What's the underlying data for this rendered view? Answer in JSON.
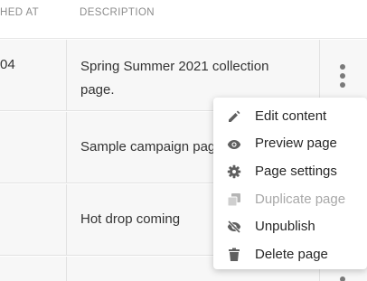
{
  "table": {
    "headers": {
      "published_at": "HED AT",
      "description": "DESCRIPTION"
    },
    "rows": [
      {
        "published_at": "04",
        "description": "Spring Summer 2021 collection page."
      },
      {
        "published_at": "",
        "description": "Sample campaign page"
      },
      {
        "published_at": "",
        "description": "Hot drop coming"
      },
      {
        "published_at": "",
        "description": ""
      }
    ]
  },
  "menu": {
    "items": [
      {
        "label": "Edit content",
        "icon": "pencil-icon",
        "disabled": false
      },
      {
        "label": "Preview page",
        "icon": "eye-icon",
        "disabled": false
      },
      {
        "label": "Page settings",
        "icon": "gear-icon",
        "disabled": false
      },
      {
        "label": "Duplicate page",
        "icon": "duplicate-icon",
        "disabled": true
      },
      {
        "label": "Unpublish",
        "icon": "eye-off-icon",
        "disabled": false
      },
      {
        "label": "Delete page",
        "icon": "trash-icon",
        "disabled": false
      }
    ]
  },
  "colors": {
    "icon": "#5f5f5f",
    "icon_disabled": "#b5b5b5",
    "row_bg": "#f7f7f7",
    "header_text": "#8c8c8c"
  }
}
